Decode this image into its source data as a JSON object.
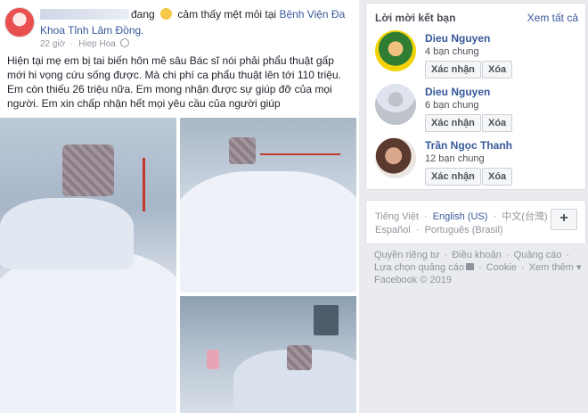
{
  "post": {
    "header_action": "đang",
    "header_feeling": "cảm thấy mệt mỏi tại",
    "header_place_part1": "Bệnh Viện Đa",
    "header_place_part2": "Khoa Tỉnh Lâm Đồng.",
    "time": "22 giờ",
    "separator": "·",
    "location": "Hiep Hoa",
    "text": "Hiện tại mẹ em bị tai biến hôn mê sâu Bác sĩ nói phải phẩu thuật gấp mới hi vọng cứu sống được. Mà chi phí ca phẩu thuật lên tới 110 triệu. Em còn thiếu 26 triệu nữa. Em mong nhận được sự giúp đỡ của mọi người. Em xin chấp nhận hết mọi yêu cầu của người giúp"
  },
  "friend_requests": {
    "title": "Lời mời kết bạn",
    "see_all": "Xem tất cả",
    "items": [
      {
        "name": "Dieu Nguyen",
        "mutual": "4 bạn chung",
        "confirm": "Xác nhận",
        "delete": "Xóa"
      },
      {
        "name": "Dieu Nguyen",
        "mutual": "6 bạn chung",
        "confirm": "Xác nhận",
        "delete": "Xóa"
      },
      {
        "name": "Trần Ngọc Thanh",
        "mutual": "12 bạn chung",
        "confirm": "Xác nhận",
        "delete": "Xóa"
      }
    ]
  },
  "languages": {
    "row1": [
      "Tiếng Việt",
      "English (US)",
      "中文(台灣)"
    ],
    "row2": [
      "Español",
      "Português (Brasil)"
    ],
    "current": "English (US)",
    "separator": "·",
    "add": "+"
  },
  "footer": {
    "privacy": "Quyền riêng tư",
    "terms": "Điều khoản",
    "ads": "Quảng cáo",
    "ad_choices": "Lựa chọn quảng cáo",
    "cookies": "Cookie",
    "more": "Xem thêm",
    "more_arrow": "▾",
    "copyright": "Facebook © 2019",
    "separator": "·"
  },
  "colors": {
    "link": "#385898",
    "background": "#e9ebee",
    "text": "#1d2129",
    "muted": "#90949c"
  }
}
